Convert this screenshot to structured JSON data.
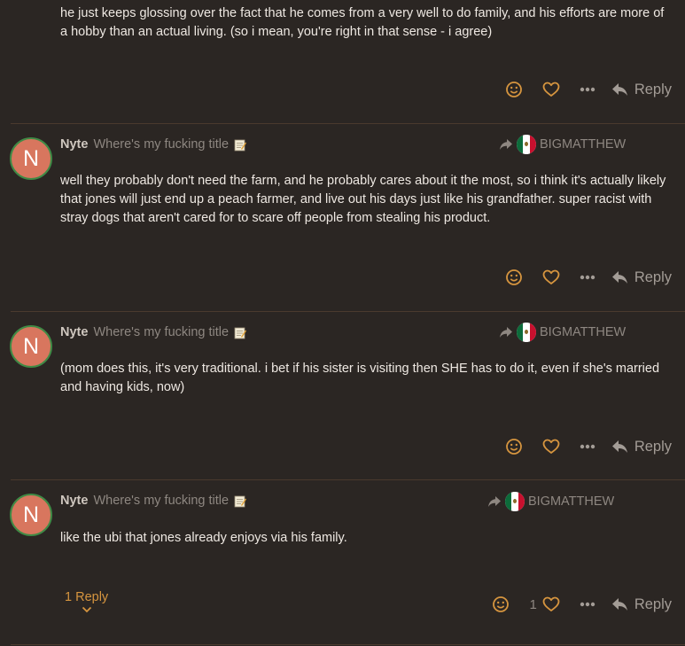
{
  "posts": [
    {
      "body": "he just keeps glossing over the fact that he comes from a very well to do family, and his efforts are more of a hobby than an actual living. (so i mean, you're right in that sense - i agree)",
      "reply_label": "Reply"
    },
    {
      "avatar_letter": "N",
      "username": "Nyte",
      "user_title": "Where's my fucking title",
      "reply_to_user": "BIGMATTHEW",
      "body": "well they probably don't need the farm, and he probably cares about it the most, so i think it's actually likely that jones will just end up a peach farmer, and live out his days just like his grandfather. super racist with stray dogs that aren't cared for to scare off people from stealing his product.",
      "reply_label": "Reply"
    },
    {
      "avatar_letter": "N",
      "username": "Nyte",
      "user_title": "Where's my fucking title",
      "reply_to_user": "BIGMATTHEW",
      "body": "(mom does this, it's very traditional. i bet if his sister is visiting then SHE has to do it, even if she's married and having kids, now)",
      "reply_label": "Reply"
    },
    {
      "avatar_letter": "N",
      "username": "Nyte",
      "user_title": "Where's my fucking title",
      "reply_to_user": "BIGMATTHEW",
      "body": "like the ubi that jones already enjoys via his family.",
      "replies_toggle": "1 Reply",
      "like_count": "1",
      "reply_label": "Reply"
    }
  ],
  "icons": {
    "emoji": "smile-icon",
    "like": "heart-icon",
    "more": "ellipsis-icon",
    "reply": "reply-arrow-icon",
    "reply_to": "share-arrow-icon",
    "memo": "memo-icon"
  },
  "colors": {
    "background": "#2b2623",
    "accent": "#d6953f",
    "divider": "#4a3a2e",
    "avatar": "#d8765e",
    "avatar_ring": "#3f8a45"
  }
}
